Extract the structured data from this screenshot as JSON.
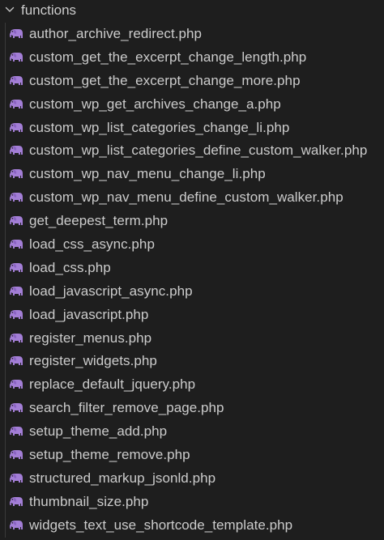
{
  "explorer": {
    "folder": {
      "name": "functions",
      "expanded": true,
      "chevron_icon": "chevron-down-icon"
    },
    "file_icon": "php-elephant-icon",
    "icon_color": "#a37ed6",
    "files": [
      "author_archive_redirect.php",
      "custom_get_the_excerpt_change_length.php",
      "custom_get_the_excerpt_change_more.php",
      "custom_wp_get_archives_change_a.php",
      "custom_wp_list_categories_change_li.php",
      "custom_wp_list_categories_define_custom_walker.php",
      "custom_wp_nav_menu_change_li.php",
      "custom_wp_nav_menu_define_custom_walker.php",
      "get_deepest_term.php",
      "load_css_async.php",
      "load_css.php",
      "load_javascript_async.php",
      "load_javascript.php",
      "register_menus.php",
      "register_widgets.php",
      "replace_default_jquery.php",
      "search_filter_remove_page.php",
      "setup_theme_add.php",
      "setup_theme_remove.php",
      "structured_markup_jsonld.php",
      "thumbnail_size.php",
      "widgets_text_use_shortcode_template.php"
    ]
  }
}
